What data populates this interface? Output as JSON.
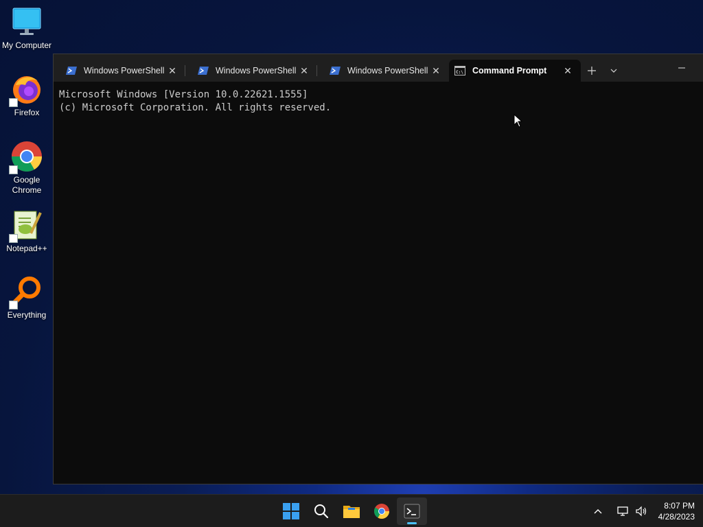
{
  "desktop": {
    "icons": [
      {
        "label": "My Computer",
        "icon": "monitor-icon"
      },
      {
        "label": "Firefox",
        "icon": "firefox-icon"
      },
      {
        "label": "Google Chrome",
        "icon": "chrome-icon"
      },
      {
        "label": "Notepad++",
        "icon": "notepadpp-icon"
      },
      {
        "label": "Everything",
        "icon": "everything-search-icon"
      }
    ]
  },
  "terminal": {
    "tabs": [
      {
        "title": "Windows PowerShell",
        "icon": "powershell-icon",
        "active": false
      },
      {
        "title": "Windows PowerShell",
        "icon": "powershell-icon",
        "active": false
      },
      {
        "title": "Windows PowerShell",
        "icon": "powershell-icon",
        "active": false
      },
      {
        "title": "Command Prompt",
        "icon": "cmd-icon",
        "active": true
      }
    ],
    "output_lines": [
      "Microsoft Windows [Version 10.0.22621.1555]",
      "(c) Microsoft Corporation. All rights reserved."
    ]
  },
  "taskbar": {
    "apps": [
      "start-icon",
      "search-icon",
      "file-explorer-icon",
      "chrome-icon",
      "terminal-icon"
    ],
    "clock": {
      "time": "8:07 PM",
      "date": "4/28/2023"
    }
  },
  "colors": {
    "terminal_bg": "#0c0c0c",
    "titlebar_bg": "#1f1f1f",
    "taskbar_bg": "#1c1c1c",
    "accent": "#4cc2ff"
  }
}
